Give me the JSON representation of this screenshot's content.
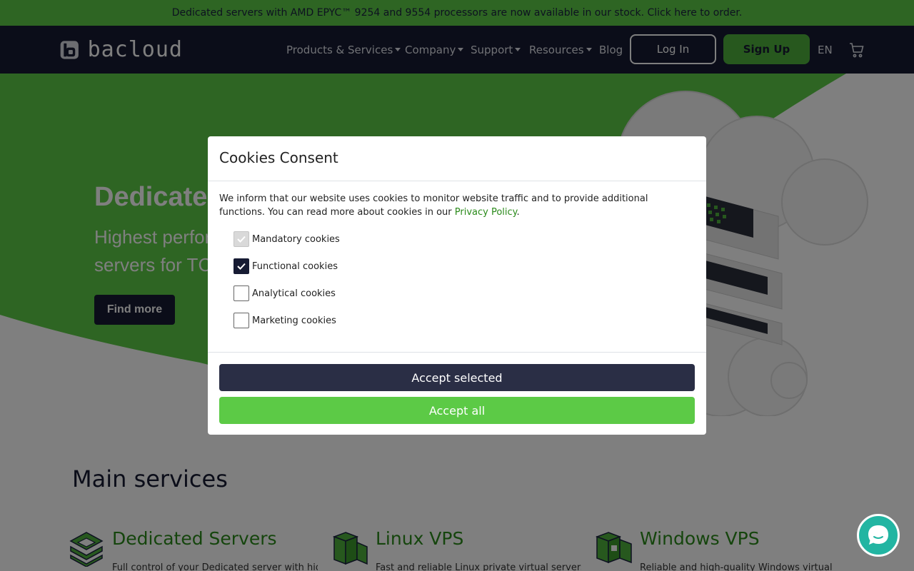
{
  "promo": {
    "text": "Dedicated servers with AMD EPYC™ 9254 and 9554 processors are now available in our stock. Click here to order."
  },
  "nav": {
    "logo_text": "bacloud",
    "items": [
      {
        "label": "Products & Services",
        "has_caret": true
      },
      {
        "label": "Company",
        "has_caret": true
      },
      {
        "label": "Support",
        "has_caret": true
      },
      {
        "label": "Resources",
        "has_caret": true
      },
      {
        "label": "Blog",
        "has_caret": false
      }
    ],
    "login_label": "Log In",
    "signup_label": "Sign Up",
    "lang_label": "EN",
    "cart_icon": "shopping-cart-icon"
  },
  "hero": {
    "title": "Dedicate",
    "subtitle_line1": "Highest perfor",
    "subtitle_line2": "servers for TC",
    "button_label": "Find more"
  },
  "services": {
    "heading": "Main services",
    "items": [
      {
        "title": "Dedicated Servers",
        "desc": "Full control of your Dedicated server with high",
        "icon": "dedicated-server-icon"
      },
      {
        "title": "Linux VPS",
        "desc": "Fast and reliable Linux private virtual servers",
        "icon": "linux-vps-icon"
      },
      {
        "title": "Windows VPS",
        "desc": "Reliable and high-quality Windows virtual",
        "icon": "windows-vps-icon"
      }
    ]
  },
  "cookie_modal": {
    "title": "Cookies Consent",
    "text_before_link": "We inform that our website uses cookies to monitor website traffic and to provide additional functions. You can read more about cookies in our ",
    "link_text": "Privacy Policy",
    "text_after_link": ".",
    "options": [
      {
        "label": "Mandatory cookies",
        "checked": true,
        "disabled": true
      },
      {
        "label": "Functional cookies",
        "checked": true,
        "disabled": false
      },
      {
        "label": "Analytical cookies",
        "checked": false,
        "disabled": false
      },
      {
        "label": "Marketing cookies",
        "checked": false,
        "disabled": false
      }
    ],
    "accept_selected_label": "Accept selected",
    "accept_all_label": "Accept all"
  },
  "colors": {
    "brand_green": "#5cca46",
    "navy": "#161b33",
    "chat_teal": "#22b5a2"
  },
  "chat": {
    "icon": "chat-bubble-icon"
  }
}
